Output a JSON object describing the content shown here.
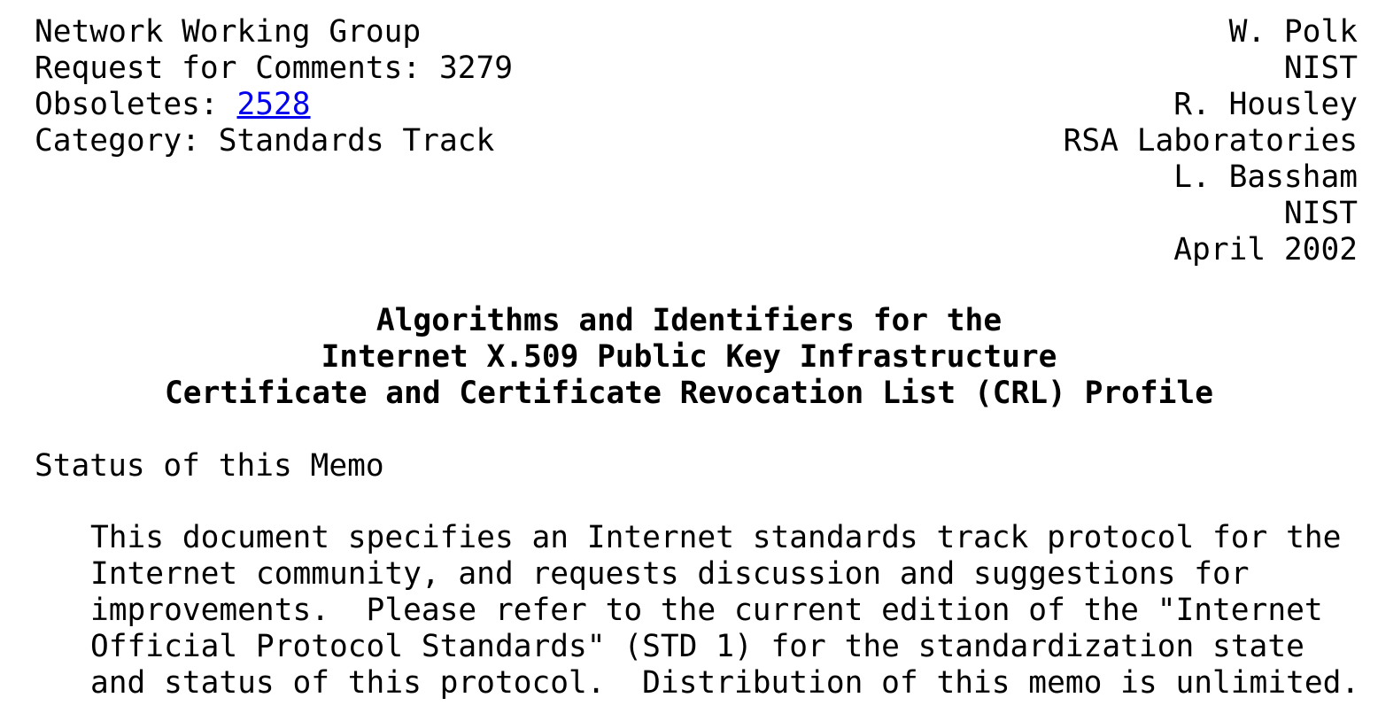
{
  "header": {
    "left": {
      "group": "Network Working Group",
      "rfc_prefix": "Request for Comments: ",
      "rfc_number": "3279",
      "obsoletes_prefix": "Obsoletes: ",
      "obsoletes_link": "2528",
      "category": "Category: Standards Track"
    },
    "right": {
      "author1": "W. Polk",
      "org1": "NIST",
      "author2": "R. Housley",
      "org2": "RSA Laboratories",
      "author3": "L. Bassham",
      "org3": "NIST",
      "date": "April 2002"
    }
  },
  "title": {
    "line1": "Algorithms and Identifiers for the",
    "line2": "Internet X.509 Public Key Infrastructure",
    "line3": "Certificate and Certificate Revocation List (CRL) Profile"
  },
  "status_section": {
    "heading": "Status of this Memo",
    "lines": [
      "This document specifies an Internet standards track protocol for the",
      "Internet community, and requests discussion and suggestions for",
      "improvements.  Please refer to the current edition of the \"Internet",
      "Official Protocol Standards\" (STD 1) for the standardization state",
      "and status of this protocol.  Distribution of this memo is unlimited."
    ]
  },
  "colors": {
    "text": "#000000",
    "link": "#0000ee",
    "background": "#ffffff"
  }
}
